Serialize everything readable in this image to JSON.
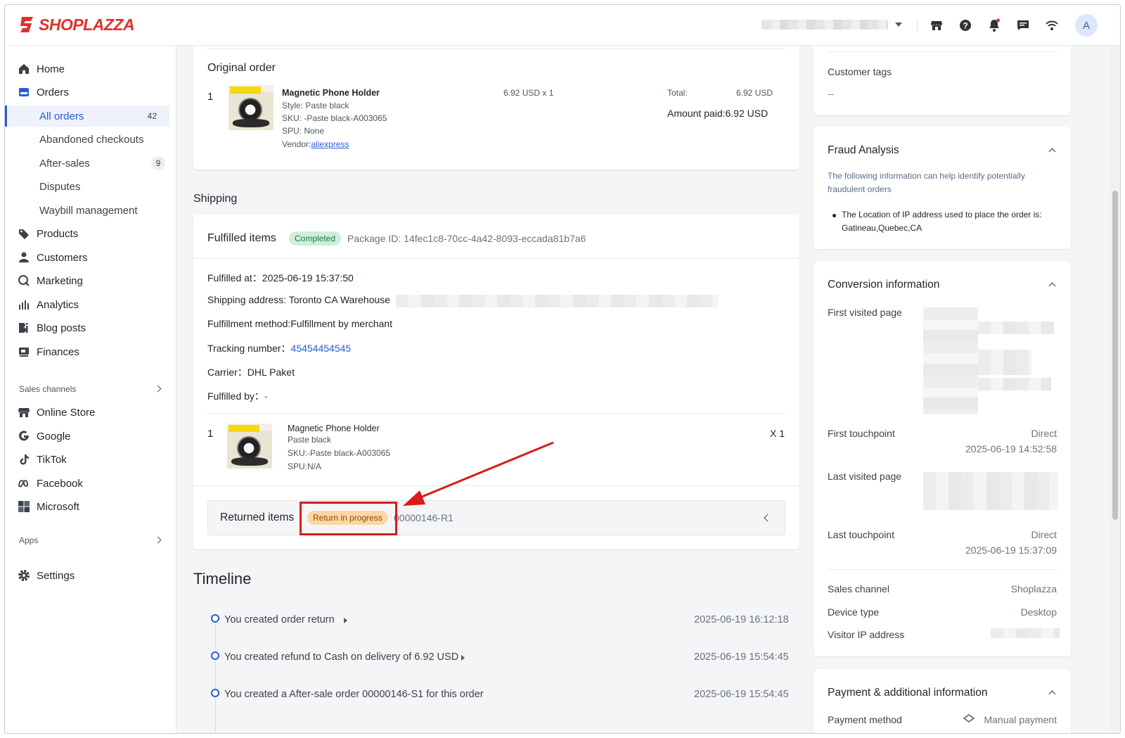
{
  "brand": {
    "name": "SHOPLAZZA",
    "color": "#e0312b"
  },
  "accent": "#2a5bd7",
  "topbar": {
    "avatar_letter": "A",
    "icons": [
      "store-icon",
      "help-icon",
      "bell-icon",
      "chat-icon",
      "wifi-icon"
    ]
  },
  "sidebar": {
    "items": [
      {
        "label": "Home",
        "icon": "home-icon"
      },
      {
        "label": "Orders",
        "icon": "orders-icon"
      },
      {
        "label": "All orders",
        "count": "42"
      },
      {
        "label": "Abandoned checkouts"
      },
      {
        "label": "After-sales",
        "count": "9"
      },
      {
        "label": "Disputes"
      },
      {
        "label": "Waybill management"
      },
      {
        "label": "Products",
        "icon": "tag-icon"
      },
      {
        "label": "Customers",
        "icon": "person-icon"
      },
      {
        "label": "Marketing",
        "icon": "megaphone-icon"
      },
      {
        "label": "Analytics",
        "icon": "bar-chart-icon"
      },
      {
        "label": "Blog posts",
        "icon": "blog-icon"
      },
      {
        "label": "Finances",
        "icon": "finance-icon"
      }
    ],
    "sales_channels_label": "Sales channels",
    "channels": [
      {
        "label": "Online Store",
        "icon": "store-icon"
      },
      {
        "label": "Google",
        "icon": "google-icon"
      },
      {
        "label": "TikTok",
        "icon": "tiktok-icon"
      },
      {
        "label": "Facebook",
        "icon": "meta-icon"
      },
      {
        "label": "Microsoft",
        "icon": "microsoft-icon"
      }
    ],
    "apps_label": "Apps",
    "settings_label": "Settings"
  },
  "original_order": {
    "title": "Original order",
    "index": "1",
    "product_name": "Magnetic Phone Holder",
    "style": "Style: Paste black",
    "sku": "SKU: -Paste black-A003065",
    "spu": "SPU: None",
    "vendor_label": "Vendor:",
    "vendor": "aliexpress",
    "price_qty": "6.92 USD x 1",
    "total_label": "Total:",
    "total_value": "6.92 USD",
    "amount_paid": "Amount paid:6.92 USD"
  },
  "shipping": {
    "title": "Shipping",
    "fulfilled_title": "Fulfilled items",
    "status": "Completed",
    "package_id": "Package ID: 14fec1c8-70cc-4a42-8093-eccada81b7a6",
    "fulfilled_at": "Fulfilled at：2025-06-19 15:37:50",
    "shipping_address": "Shipping address: Toronto CA Warehouse",
    "fulfillment_method": "Fulfillment method:Fulfillment by merchant",
    "tracking_label": "Tracking number：",
    "tracking_number": "45454454545",
    "carrier": "Carrier：DHL Paket",
    "fulfilled_by_label": "Fulfilled by：",
    "fulfilled_by": "-",
    "item": {
      "index": "1",
      "name": "Magnetic Phone Holder",
      "variant": "Paste black",
      "sku": "SKU:-Paste black-A003065",
      "spu": "SPU:N/A",
      "qty": "X 1"
    },
    "returned_title": "Returned items",
    "return_status": "Return in progress",
    "return_id": "00000146-R1"
  },
  "timeline": {
    "title": "Timeline",
    "events": [
      {
        "text": "You created order return",
        "time": "2025-06-19 16:12:18",
        "expandable": true
      },
      {
        "text": "You created refund to Cash on delivery of 6.92 USD",
        "time": "2025-06-19 15:54:45",
        "expandable": true
      },
      {
        "text": "You created a After-sale order 00000146-S1 for this order",
        "time": "2025-06-19 15:54:45",
        "expandable": false
      }
    ]
  },
  "right": {
    "customer_tags_label": "Customer tags",
    "customer_tags_value": "--",
    "fraud": {
      "title": "Fraud Analysis",
      "desc": "The following information can help identify potentially fraudulent orders",
      "bullet": "The Location of IP address used to place the order is: Gatineau,Quebec,CA"
    },
    "conversion": {
      "title": "Conversion information",
      "first_visited_label": "First visited page",
      "first_touchpoint_label": "First touchpoint",
      "first_touchpoint_value": "Direct",
      "first_touchpoint_time": "2025-06-19 14:52:58",
      "last_visited_label": "Last visited page",
      "last_touchpoint_label": "Last touchpoint",
      "last_touchpoint_value": "Direct",
      "last_touchpoint_time": "2025-06-19 15:37:09",
      "sales_channel_label": "Sales channel",
      "sales_channel_value": "Shoplazza",
      "device_type_label": "Device type",
      "device_type_value": "Desktop",
      "visitor_ip_label": "Visitor IP address"
    },
    "payment": {
      "title": "Payment & additional information",
      "method_label": "Payment method",
      "method_value": "Manual payment"
    }
  }
}
